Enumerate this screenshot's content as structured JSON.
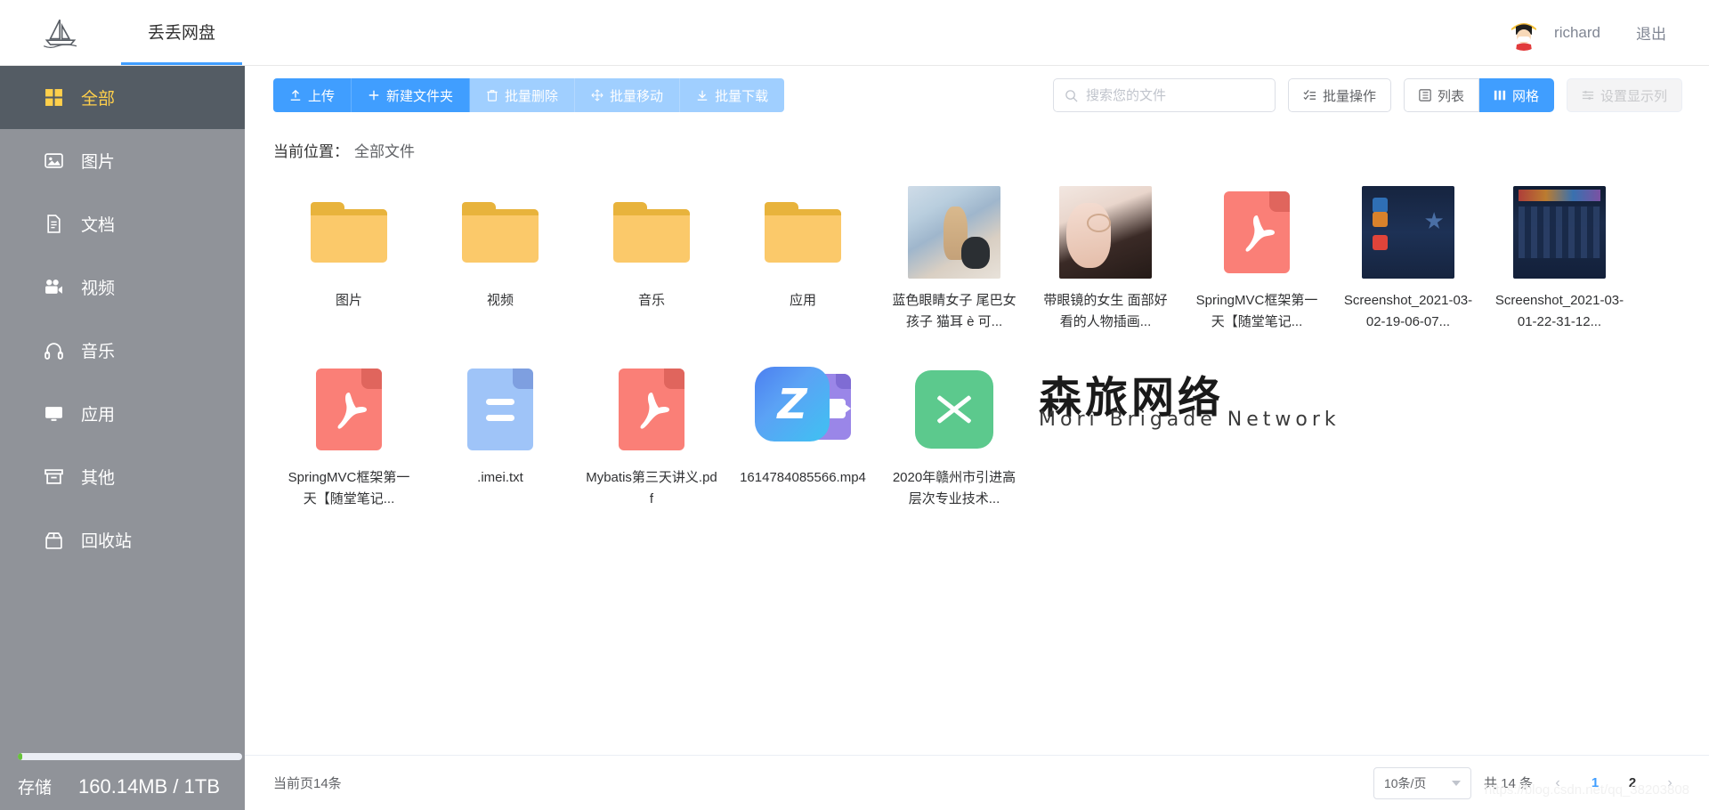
{
  "header": {
    "logo_icon": "sailboat-icon",
    "brand_tab": "丢丢网盘",
    "user_name": "richard",
    "avatar_icon": "user-avatar",
    "logout_label": "退出"
  },
  "sidebar": {
    "items": [
      {
        "label": "全部",
        "icon": "grid-icon",
        "active": true
      },
      {
        "label": "图片",
        "icon": "image-icon",
        "active": false
      },
      {
        "label": "文档",
        "icon": "document-icon",
        "active": false
      },
      {
        "label": "视频",
        "icon": "video-icon",
        "active": false
      },
      {
        "label": "音乐",
        "icon": "headphone-icon",
        "active": false
      },
      {
        "label": "应用",
        "icon": "monitor-icon",
        "active": false
      },
      {
        "label": "其他",
        "icon": "box-icon",
        "active": false
      },
      {
        "label": "回收站",
        "icon": "trash-icon",
        "active": false
      }
    ],
    "storage": {
      "label": "存储",
      "value": "160.14MB / 1TB",
      "percent": 2
    },
    "collapse_icon": "chevron-left-icon"
  },
  "toolbar": {
    "primary_buttons": [
      {
        "label": "上传",
        "icon": "upload-icon",
        "disabled": false
      },
      {
        "label": "新建文件夹",
        "icon": "plus-icon",
        "disabled": false
      },
      {
        "label": "批量删除",
        "icon": "trash-icon",
        "disabled": true
      },
      {
        "label": "批量移动",
        "icon": "move-icon",
        "disabled": true
      },
      {
        "label": "批量下载",
        "icon": "download-icon",
        "disabled": true
      }
    ],
    "search": {
      "placeholder": "搜索您的文件",
      "value": "",
      "icon": "search-icon"
    },
    "batch_ops": {
      "label": "批量操作",
      "icon": "checklist-icon"
    },
    "view_modes": [
      {
        "label": "列表",
        "icon": "list-icon",
        "active": false
      },
      {
        "label": "网格",
        "icon": "grid-view-icon",
        "active": true
      }
    ],
    "settings_columns": {
      "label": "设置显示列",
      "icon": "columns-icon"
    }
  },
  "breadcrumb": {
    "label": "当前位置：",
    "value": "全部文件"
  },
  "files": [
    {
      "name": "图片",
      "kind": "folder"
    },
    {
      "name": "视频",
      "kind": "folder"
    },
    {
      "name": "音乐",
      "kind": "folder"
    },
    {
      "name": "应用",
      "kind": "folder"
    },
    {
      "name": "蓝色眼睛女子 尾巴女孩子 猫耳 è 可...",
      "kind": "photo-anime"
    },
    {
      "name": "带眼镜的女生 面部好看的人物插画...",
      "kind": "photo-girl"
    },
    {
      "name": "SpringMVC框架第一天【随堂笔记...",
      "kind": "pdf"
    },
    {
      "name": "Screenshot_2021-03-02-19-06-07...",
      "kind": "photo-game1"
    },
    {
      "name": "Screenshot_2021-03-01-22-31-12...",
      "kind": "photo-game2"
    },
    {
      "name": "SpringMVC框架第一天【随堂笔记...",
      "kind": "pdf"
    },
    {
      "name": ".imei.txt",
      "kind": "txt"
    },
    {
      "name": "Mybatis第三天讲义.pdf",
      "kind": "pdf"
    },
    {
      "name": "1614784085566.mp4",
      "kind": "mp4"
    },
    {
      "name": "2020年赣州市引进高层次专业技术...",
      "kind": "xls"
    }
  ],
  "watermark": {
    "cn": "森旅网络",
    "en": "Mori Brigade Network",
    "url": "https://blog.csdn.net/qq_38203808"
  },
  "footer": {
    "current_count": "当前页14条",
    "page_size": "10条/页",
    "total": "共 14 条",
    "prev_icon": "chevron-left-icon",
    "next_icon": "chevron-right-icon",
    "pages": [
      "1",
      "2"
    ],
    "current_page": "1"
  },
  "colors": {
    "primary": "#409eff",
    "sidebar_bg": "#909399",
    "sidebar_active_bg": "#545c64",
    "sidebar_active_text": "#ffd04b",
    "folder": "#fbc96a",
    "pdf": "#fa7f77",
    "txt": "#9fc4f8"
  }
}
